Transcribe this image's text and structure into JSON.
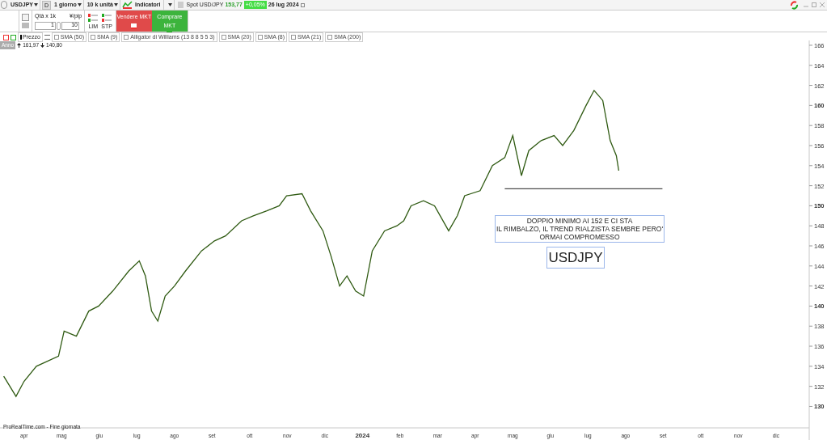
{
  "toolbar": {
    "symbol": "USDJPY",
    "period_letter": "D",
    "timeframe": "1 giorno",
    "units": "10 k unità",
    "indicators": "Indicatori",
    "quote": {
      "label": "Spot USD/JPY",
      "price": "153,77",
      "change": "+0,05%",
      "date": "26 lug 2024"
    }
  },
  "order_panel": {
    "qty_label": "Qtà x 1k",
    "qty_value": "1",
    "pip_label": "¥/pip",
    "pip_value": "10",
    "lim": "LIM",
    "stp": "STP",
    "sell": "Vendere MKT",
    "buy": "Comprare MKT"
  },
  "indicator_bar": {
    "price": "Prezzo",
    "indicators": [
      {
        "label": "SMA (50)",
        "checked": false
      },
      {
        "label": "SMA (9)",
        "checked": false
      },
      {
        "label": "Alligator di Williams (13 8 8 5 5 3)",
        "checked": false
      },
      {
        "label": "SMA (20)",
        "checked": false
      },
      {
        "label": "SMA (8)",
        "checked": false
      },
      {
        "label": "SMA (21)",
        "checked": false
      },
      {
        "label": "SMA (200)",
        "checked": false
      }
    ]
  },
  "range": {
    "label": "Anno",
    "high": "161,97",
    "low": "140,80"
  },
  "chart_data": {
    "type": "line",
    "xlim": [
      "2023-03-12",
      "2024-12-28"
    ],
    "ylim": [
      127.86,
      166.48
    ],
    "yticks": [
      {
        "value": 130,
        "label": "130"
      },
      {
        "value": 132,
        "label": "132"
      },
      {
        "value": 134,
        "label": "134"
      },
      {
        "value": 136,
        "label": "136"
      },
      {
        "value": 138,
        "label": "138"
      },
      {
        "value": 140,
        "label": "140"
      },
      {
        "value": 142,
        "label": "142"
      },
      {
        "value": 144,
        "label": "144"
      },
      {
        "value": 146,
        "label": "146"
      },
      {
        "value": 148,
        "label": "148"
      },
      {
        "value": 150,
        "label": "150"
      },
      {
        "value": 152,
        "label": "152"
      },
      {
        "value": 154,
        "label": "154"
      },
      {
        "value": 156,
        "label": "156"
      },
      {
        "value": 158,
        "label": "158"
      },
      {
        "value": 160,
        "label": "160"
      },
      {
        "value": 162,
        "label": "162"
      },
      {
        "value": 164,
        "label": "164"
      },
      {
        "value": 166,
        "label": "166"
      }
    ],
    "xticks": [
      {
        "value": "2023-04-01",
        "label": "apr"
      },
      {
        "value": "2023-05-01",
        "label": "mag"
      },
      {
        "value": "2023-06-01",
        "label": "giu"
      },
      {
        "value": "2023-07-01",
        "label": "lug"
      },
      {
        "value": "2023-08-01",
        "label": "ago"
      },
      {
        "value": "2023-09-01",
        "label": "set"
      },
      {
        "value": "2023-10-01",
        "label": "ott"
      },
      {
        "value": "2023-11-01",
        "label": "nov"
      },
      {
        "value": "2023-12-01",
        "label": "dic"
      },
      {
        "value": "2024-01-01",
        "label": "2024"
      },
      {
        "value": "2024-02-01",
        "label": "feb"
      },
      {
        "value": "2024-03-01",
        "label": "mar"
      },
      {
        "value": "2024-04-01",
        "label": "apr"
      },
      {
        "value": "2024-05-01",
        "label": "mag"
      },
      {
        "value": "2024-06-01",
        "label": "giu"
      },
      {
        "value": "2024-07-01",
        "label": "lug"
      },
      {
        "value": "2024-08-01",
        "label": "ago"
      },
      {
        "value": "2024-09-01",
        "label": "set"
      },
      {
        "value": "2024-10-01",
        "label": "ott"
      },
      {
        "value": "2024-11-01",
        "label": "nov"
      },
      {
        "value": "2024-12-01",
        "label": "dic"
      }
    ],
    "x": [
      "2023-03-15",
      "2023-03-25",
      "2023-04-01",
      "2023-04-11",
      "2023-04-29",
      "2023-05-03",
      "2023-05-13",
      "2023-05-23",
      "2023-05-31",
      "2023-06-12",
      "2023-06-25",
      "2023-07-03",
      "2023-07-08",
      "2023-07-13",
      "2023-07-18",
      "2023-07-24",
      "2023-08-01",
      "2023-08-10",
      "2023-08-23",
      "2023-09-03",
      "2023-09-12",
      "2023-09-25",
      "2023-10-04",
      "2023-10-15",
      "2023-10-25",
      "2023-10-31",
      "2023-11-13",
      "2023-11-20",
      "2023-11-30",
      "2023-12-06",
      "2023-12-13",
      "2023-12-19",
      "2023-12-26",
      "2024-01-02",
      "2024-01-09",
      "2024-01-19",
      "2024-01-29",
      "2024-02-04",
      "2024-02-10",
      "2024-02-20",
      "2024-02-29",
      "2024-03-10",
      "2024-03-17",
      "2024-03-23",
      "2024-04-05",
      "2024-04-15",
      "2024-04-25",
      "2024-05-01",
      "2024-05-08",
      "2024-05-14",
      "2024-05-24",
      "2024-06-04",
      "2024-06-11",
      "2024-06-20",
      "2024-06-30",
      "2024-07-06",
      "2024-07-13",
      "2024-07-19",
      "2024-07-24",
      "2024-07-26"
    ],
    "series": [
      {
        "name": "USDJPY",
        "color": "#2f5a12",
        "values": [
          133,
          131,
          132.5,
          134,
          135,
          137.5,
          137,
          139.5,
          140,
          141.5,
          143.5,
          144.5,
          143,
          139.5,
          138.5,
          141,
          142,
          143.5,
          145.5,
          146.5,
          147,
          148.5,
          149,
          149.5,
          150,
          151,
          151.2,
          149.5,
          147.5,
          145,
          142,
          143,
          141.5,
          141,
          145.5,
          147.5,
          148,
          148.5,
          150,
          150.5,
          150,
          147.5,
          149,
          151,
          151.5,
          154,
          154.8,
          157,
          153,
          155.5,
          156.5,
          157,
          156,
          157.5,
          160,
          161.5,
          160.5,
          156.5,
          155,
          153.5
        ]
      }
    ],
    "ref_lines": [
      {
        "axis": "y",
        "value": 151.7
      }
    ]
  },
  "note": [
    "DOPPIO MINIMO AI 152 E CI STA",
    "IL RIMBALZO, IL TREND RIALZISTA SEMBRE PERO'",
    "ORMAI COMPROMESSO"
  ],
  "footer": "ProRealTime.com - Fine giornata"
}
